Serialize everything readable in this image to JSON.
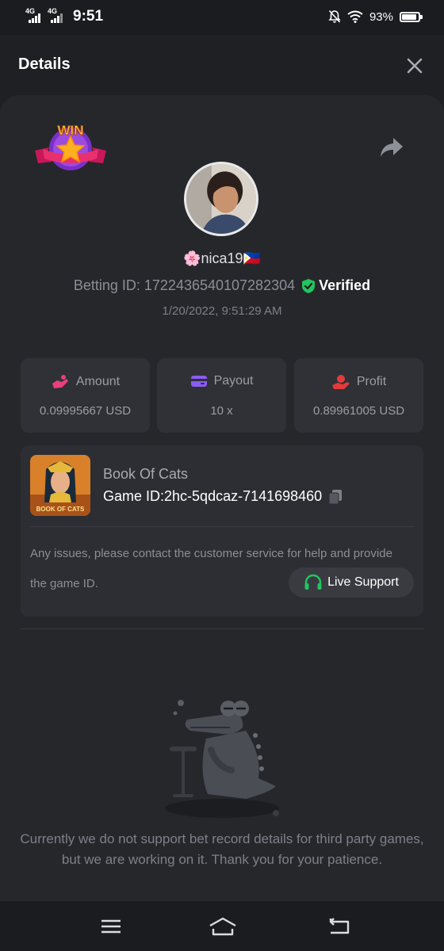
{
  "status_bar": {
    "network1": "4G",
    "network2": "4G",
    "time": "9:51",
    "battery": "93%"
  },
  "header": {
    "title": "Details"
  },
  "badge": {
    "text": "WIN"
  },
  "bet": {
    "username": "🌸nica19🇵🇭",
    "betting_id": "Betting ID: 1722436540107282304",
    "verified": "Verified",
    "datetime": "1/20/2022, 9:51:29 AM"
  },
  "stats": [
    {
      "label": "Amount",
      "value": "0.09995667 USD",
      "icon": "money-hand-icon",
      "color": "#e8407a"
    },
    {
      "label": "Payout",
      "value": "10 x",
      "icon": "wallet-icon",
      "color": "#8b5cf6"
    },
    {
      "label": "Profit",
      "value": "0.89961005 USD",
      "icon": "profit-hand-icon",
      "color": "#e23b3b"
    }
  ],
  "game": {
    "name": "Book Of Cats",
    "id_label": "Game ID:",
    "id_value": "2hc-5qdcaz-7141698460",
    "thumb_text": "BOOK OF CATS",
    "issue_text": "Any issues, please contact the customer service for help and provide the game ID.",
    "support_label": "Live Support"
  },
  "notice": "Currently we do not support bet record details for third party games, but we are working on it. Thank you for your patience.",
  "colors": {
    "background": "#1e2023",
    "card": "#2f3136",
    "verified_green": "#22c55e",
    "support_green": "#22c55e"
  }
}
